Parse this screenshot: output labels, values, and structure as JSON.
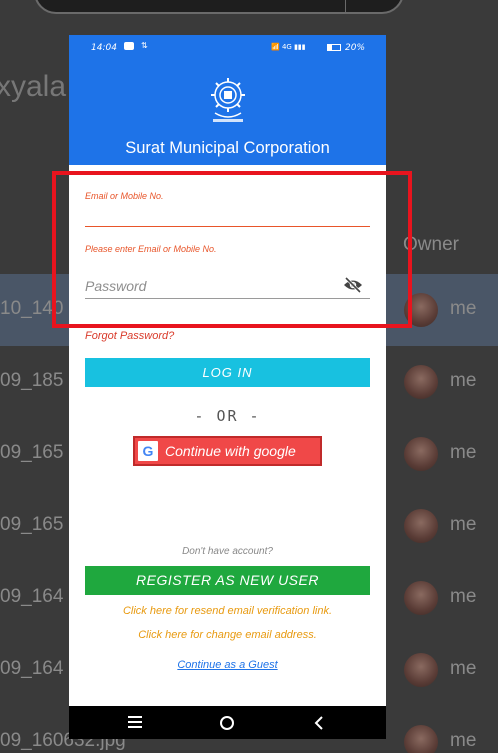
{
  "background": {
    "title_fragment": "xyala",
    "owner_header": "Owner",
    "rows": [
      {
        "name": "10_140",
        "owner": "me",
        "selected": true
      },
      {
        "name": "09_185",
        "owner": "me",
        "selected": false
      },
      {
        "name": "09_165",
        "owner": "me",
        "selected": false
      },
      {
        "name": "09_165",
        "owner": "me",
        "selected": false
      },
      {
        "name": "09_164",
        "owner": "me",
        "selected": false
      },
      {
        "name": "09_164",
        "owner": "me",
        "selected": false
      },
      {
        "name": "09_160632.jpg",
        "owner": "me",
        "selected": false
      }
    ]
  },
  "status_bar": {
    "time": "14:04",
    "network": "4G",
    "battery": "20%"
  },
  "header": {
    "title": "Surat Municipal Corporation",
    "logo_icon": "smc-emblem-icon"
  },
  "form": {
    "email_label": "Email or Mobile No.",
    "email_value": "",
    "email_error": "Please enter Email or Mobile No.",
    "password_placeholder": "Password",
    "forgot_password": "Forgot Password?",
    "login_label": "LOG IN",
    "or_text": "- OR -",
    "google_label": "Continue with google",
    "no_account": "Don't have account?",
    "register_label": "REGISTER AS NEW USER",
    "resend_link": "Click here for resend email verification link.",
    "change_link": "Click here for change email address.",
    "guest_link": "Continue as a Guest"
  },
  "colors": {
    "header_blue": "#1e73e8",
    "login_cyan": "#18c1e0",
    "google_red": "#f04848",
    "register_green": "#1fa83e",
    "link_orange": "#e89a10",
    "error_orange": "#e8552a",
    "highlight_red": "#e8141e"
  }
}
